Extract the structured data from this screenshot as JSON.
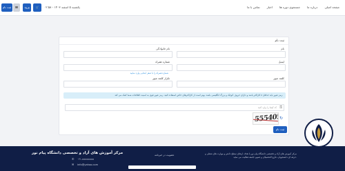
{
  "topbar": {
    "login_label": "ثبت نام",
    "phone_label": "☎",
    "user_label": "ورود",
    "cart_label": "🛒",
    "date_text": "یکشنبه ۵ اسفند ۱۴۰۳ - ۰۲:۵۸",
    "nav": [
      "صفحه اصلی",
      "درباره ما",
      "جستجوی دوره ها",
      "اخبار",
      "تماس با ما"
    ]
  },
  "form": {
    "title": "ثبت نام",
    "first_name_label": "نام",
    "last_name_label": "نام خانوادگی",
    "email_label": "ایمیل",
    "mobile_label": "شماره همراه",
    "mobile_hint": "شماره همراه را با صفر ابتدایی وارد نمایید",
    "password_label": "کلمه عبور",
    "password_confirm_label": "تکرار کلمه عبور",
    "notice": "رمز عبور باید حداقل ۸ کاراکتر باشد و دارای حروف کوچک و بزرگ انگلیسی باشد. بهتر است از کاراکترهای خاص استفاده کنید. رمز عبور قوی به امنیت اطلاعات شما کمک می کند.",
    "captcha_placeholder": "کد کپچا را وارد کنید",
    "captcha_code": "555405",
    "submit_label": "ثبت نام"
  },
  "footer": {
    "about_text": "مرکز آموزش های آزاد و تخصصی دانشگاه پیام نور با هدف ارتقای سطح دانش و مهارت های شغلی و حرفه ای دانشجویان، فارغ التحصیلان و عموم جامعه فعالیت می نماید.",
    "newsletter_title": "عضویت در خبرنامه",
    "brand": "مرکز آموزش های آزاد و تخصصی دانشگاه پیام نور",
    "contact_phone": "۰۲۱-xxxxxxxx",
    "contact_email": "info@yahoo.com"
  }
}
